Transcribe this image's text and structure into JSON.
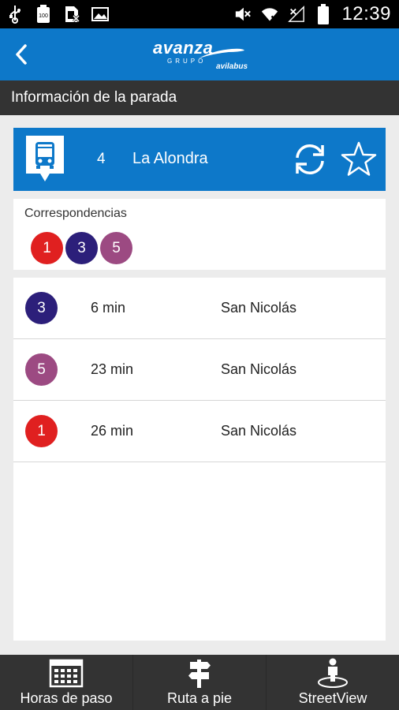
{
  "status_bar": {
    "time": "12:39",
    "battery_label": "100"
  },
  "app_bar": {
    "logo_brand": "avanza",
    "logo_group": "GRUPO",
    "logo_sub": "avilabus"
  },
  "section": {
    "title": "Información de la parada"
  },
  "stop": {
    "number": "4",
    "name": "La Alondra"
  },
  "correspondences": {
    "title": "Correspondencias",
    "lines": [
      {
        "label": "1",
        "color": "#e02020"
      },
      {
        "label": "3",
        "color": "#2c1f7a"
      },
      {
        "label": "5",
        "color": "#9c4a82"
      }
    ]
  },
  "arrivals": [
    {
      "line": "3",
      "color": "#2c1f7a",
      "time": "6 min",
      "destination": "San Nicolás"
    },
    {
      "line": "5",
      "color": "#9c4a82",
      "time": "23 min",
      "destination": "San Nicolás"
    },
    {
      "line": "1",
      "color": "#e02020",
      "time": "26 min",
      "destination": "San Nicolás"
    }
  ],
  "bottom_nav": {
    "items": [
      {
        "label": "Horas de paso",
        "icon": "calendar-icon"
      },
      {
        "label": "Ruta a pie",
        "icon": "signpost-icon"
      },
      {
        "label": "StreetView",
        "icon": "person-map-icon"
      }
    ]
  },
  "colors": {
    "primary": "#0d78c9",
    "dark": "#333333"
  }
}
